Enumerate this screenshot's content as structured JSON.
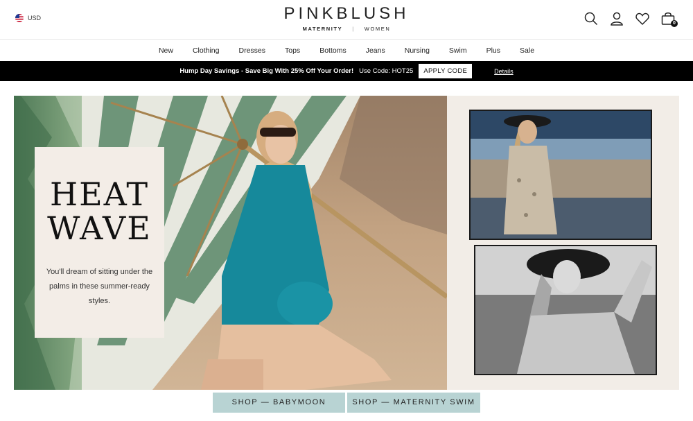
{
  "header": {
    "currency": "USD",
    "logo": "PINKBLUSH",
    "logo_left": "MATERNITY",
    "logo_sep": "|",
    "logo_right": "WOMEN",
    "cart_count": "0",
    "icons": [
      "search-icon",
      "account-icon",
      "wishlist-heart-icon",
      "cart-bag-icon"
    ]
  },
  "nav": {
    "items": [
      "New",
      "Clothing",
      "Dresses",
      "Tops",
      "Bottoms",
      "Jeans",
      "Nursing",
      "Swim",
      "Plus",
      "Sale"
    ]
  },
  "promo": {
    "message": "Hump Day Savings - Save Big With 25% Off Your Order!",
    "code": "Use Code: HOT25",
    "apply_label": "APPLY CODE",
    "details_label": "Details"
  },
  "hero": {
    "headline_line1": "HEAT",
    "headline_line2": "WAVE",
    "tagline": "You'll dream of sitting under the palms in these summer-ready styles."
  },
  "shop": {
    "button1": "SHOP  —  BABYMOON",
    "button2": "SHOP  —  MATERNITY SWIM"
  },
  "colors": {
    "promo_bg": "#000000",
    "shop_button_bg": "#b8d3d3",
    "swimsuit_teal": "#16899b",
    "card_bg": "#f3ede7"
  }
}
